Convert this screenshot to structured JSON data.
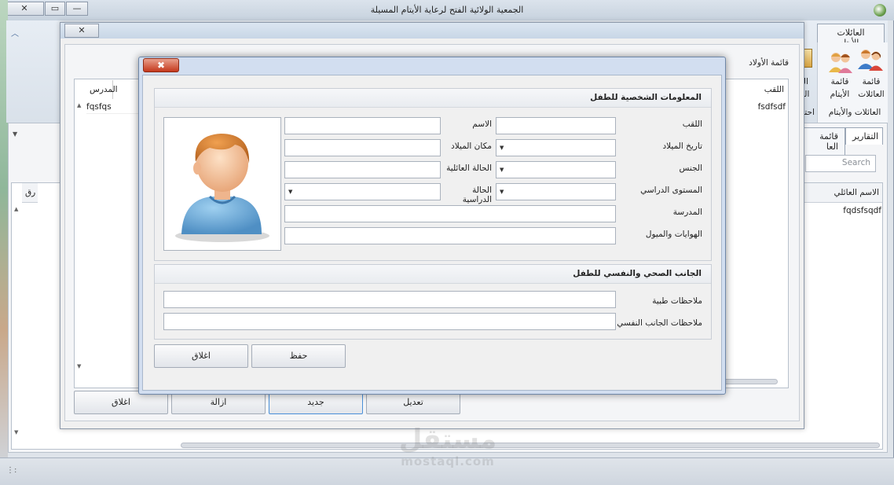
{
  "app": {
    "title": "الجمعية الولائية الفتح لرعاية الأيتام المسيلة"
  },
  "window_buttons": {
    "close": "✕",
    "restore": "▭",
    "minimize": "—"
  },
  "ribbon": {
    "tab_active": "العائلات والأيتام",
    "buttons": [
      {
        "label": "قائمة العائلات",
        "icon": "families-icon"
      },
      {
        "label": "قائمة الأيتام",
        "icon": "orphans-icon"
      }
    ],
    "partial_labels": [
      "الح",
      "العا",
      "احتيا"
    ],
    "group_label": "العائلات والأيتام"
  },
  "main_tabs": {
    "reports": "التقارير",
    "families_list": "قائمة العا"
  },
  "main_search": {
    "placeholder": "Search"
  },
  "main_grid": {
    "col_family_name": "الاسم العائلي",
    "col_num": "رق",
    "row1": "fqdsfsqdf"
  },
  "children_window": {
    "title": "قائمة الأولاد",
    "col_lastname": "اللقب",
    "col_school": "المدرس",
    "row_lastname": "fsdfsdf",
    "row_school": "fqsfqs",
    "buttons": {
      "edit": "تعديل",
      "new": "جديد",
      "delete": "ازالة",
      "close": "اغلاق"
    }
  },
  "child_form": {
    "close_x": "✖",
    "personal_section": "المعلومات الشخصية للطفل",
    "fields": {
      "lastname": "اللقب",
      "firstname": "الاسم",
      "birth_date": "تاريخ الميلاد",
      "birth_place": "مكان الميلاد",
      "gender": "الجنس",
      "family_status": "الحالة العائلية",
      "study_level": "المستوى الدراسي",
      "study_status": "الحالة الدراسية",
      "school": "المدرسة",
      "hobbies": "الهوايات والميول"
    },
    "health_section": "الجانب الصحي والنفسي للطفل",
    "medical_notes": "ملاحظات طبية",
    "psych_notes": "ملاحظات الجانب النفسي",
    "save_button": "حفظ",
    "close_button": "اغلاق"
  },
  "watermark": {
    "text_ar": "مستقل",
    "text_en": "mostaql.com"
  }
}
